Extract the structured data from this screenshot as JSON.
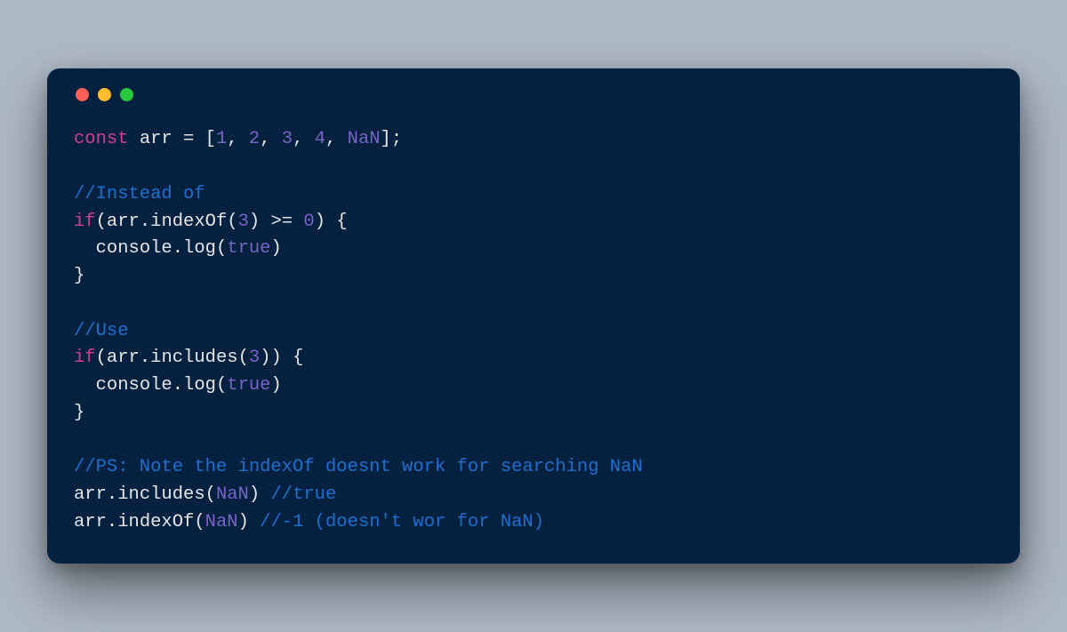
{
  "colors": {
    "page_bg": "#aeb9c6",
    "window_bg": "#04213f",
    "traffic_red": "#ff5f57",
    "traffic_yellow": "#febc2e",
    "traffic_green": "#28c840",
    "keyword": "#d43f8d",
    "number_const": "#7a63c6",
    "comment": "#1f6fd0",
    "default_text": "#e6e6e6"
  },
  "code_lines": [
    [
      {
        "t": "keyword",
        "v": "const"
      },
      {
        "t": "punct",
        "v": " "
      },
      {
        "t": "ident",
        "v": "arr"
      },
      {
        "t": "punct",
        "v": " = ["
      },
      {
        "t": "number",
        "v": "1"
      },
      {
        "t": "punct",
        "v": ", "
      },
      {
        "t": "number",
        "v": "2"
      },
      {
        "t": "punct",
        "v": ", "
      },
      {
        "t": "number",
        "v": "3"
      },
      {
        "t": "punct",
        "v": ", "
      },
      {
        "t": "number",
        "v": "4"
      },
      {
        "t": "punct",
        "v": ", "
      },
      {
        "t": "const",
        "v": "NaN"
      },
      {
        "t": "punct",
        "v": "];"
      }
    ],
    [],
    [
      {
        "t": "comment",
        "v": "//Instead of"
      }
    ],
    [
      {
        "t": "keyword",
        "v": "if"
      },
      {
        "t": "punct",
        "v": "("
      },
      {
        "t": "ident",
        "v": "arr"
      },
      {
        "t": "punct",
        "v": "."
      },
      {
        "t": "method",
        "v": "indexOf"
      },
      {
        "t": "punct",
        "v": "("
      },
      {
        "t": "number",
        "v": "3"
      },
      {
        "t": "punct",
        "v": ") >= "
      },
      {
        "t": "number",
        "v": "0"
      },
      {
        "t": "punct",
        "v": ") {"
      }
    ],
    [
      {
        "t": "punct",
        "v": "  "
      },
      {
        "t": "ident",
        "v": "console"
      },
      {
        "t": "punct",
        "v": "."
      },
      {
        "t": "method",
        "v": "log"
      },
      {
        "t": "punct",
        "v": "("
      },
      {
        "t": "const",
        "v": "true"
      },
      {
        "t": "punct",
        "v": ")"
      }
    ],
    [
      {
        "t": "punct",
        "v": "}"
      }
    ],
    [],
    [
      {
        "t": "comment",
        "v": "//Use"
      }
    ],
    [
      {
        "t": "keyword",
        "v": "if"
      },
      {
        "t": "punct",
        "v": "("
      },
      {
        "t": "ident",
        "v": "arr"
      },
      {
        "t": "punct",
        "v": "."
      },
      {
        "t": "method",
        "v": "includes"
      },
      {
        "t": "punct",
        "v": "("
      },
      {
        "t": "number",
        "v": "3"
      },
      {
        "t": "punct",
        "v": ")) {"
      }
    ],
    [
      {
        "t": "punct",
        "v": "  "
      },
      {
        "t": "ident",
        "v": "console"
      },
      {
        "t": "punct",
        "v": "."
      },
      {
        "t": "method",
        "v": "log"
      },
      {
        "t": "punct",
        "v": "("
      },
      {
        "t": "const",
        "v": "true"
      },
      {
        "t": "punct",
        "v": ")"
      }
    ],
    [
      {
        "t": "punct",
        "v": "}"
      }
    ],
    [],
    [
      {
        "t": "comment",
        "v": "//PS: Note the indexOf doesnt work for searching NaN"
      }
    ],
    [
      {
        "t": "ident",
        "v": "arr"
      },
      {
        "t": "punct",
        "v": "."
      },
      {
        "t": "method",
        "v": "includes"
      },
      {
        "t": "punct",
        "v": "("
      },
      {
        "t": "const",
        "v": "NaN"
      },
      {
        "t": "punct",
        "v": ") "
      },
      {
        "t": "comment",
        "v": "//true"
      }
    ],
    [
      {
        "t": "ident",
        "v": "arr"
      },
      {
        "t": "punct",
        "v": "."
      },
      {
        "t": "method",
        "v": "indexOf"
      },
      {
        "t": "punct",
        "v": "("
      },
      {
        "t": "const",
        "v": "NaN"
      },
      {
        "t": "punct",
        "v": ") "
      },
      {
        "t": "comment",
        "v": "//-1 (doesn't wor for NaN)"
      }
    ]
  ]
}
